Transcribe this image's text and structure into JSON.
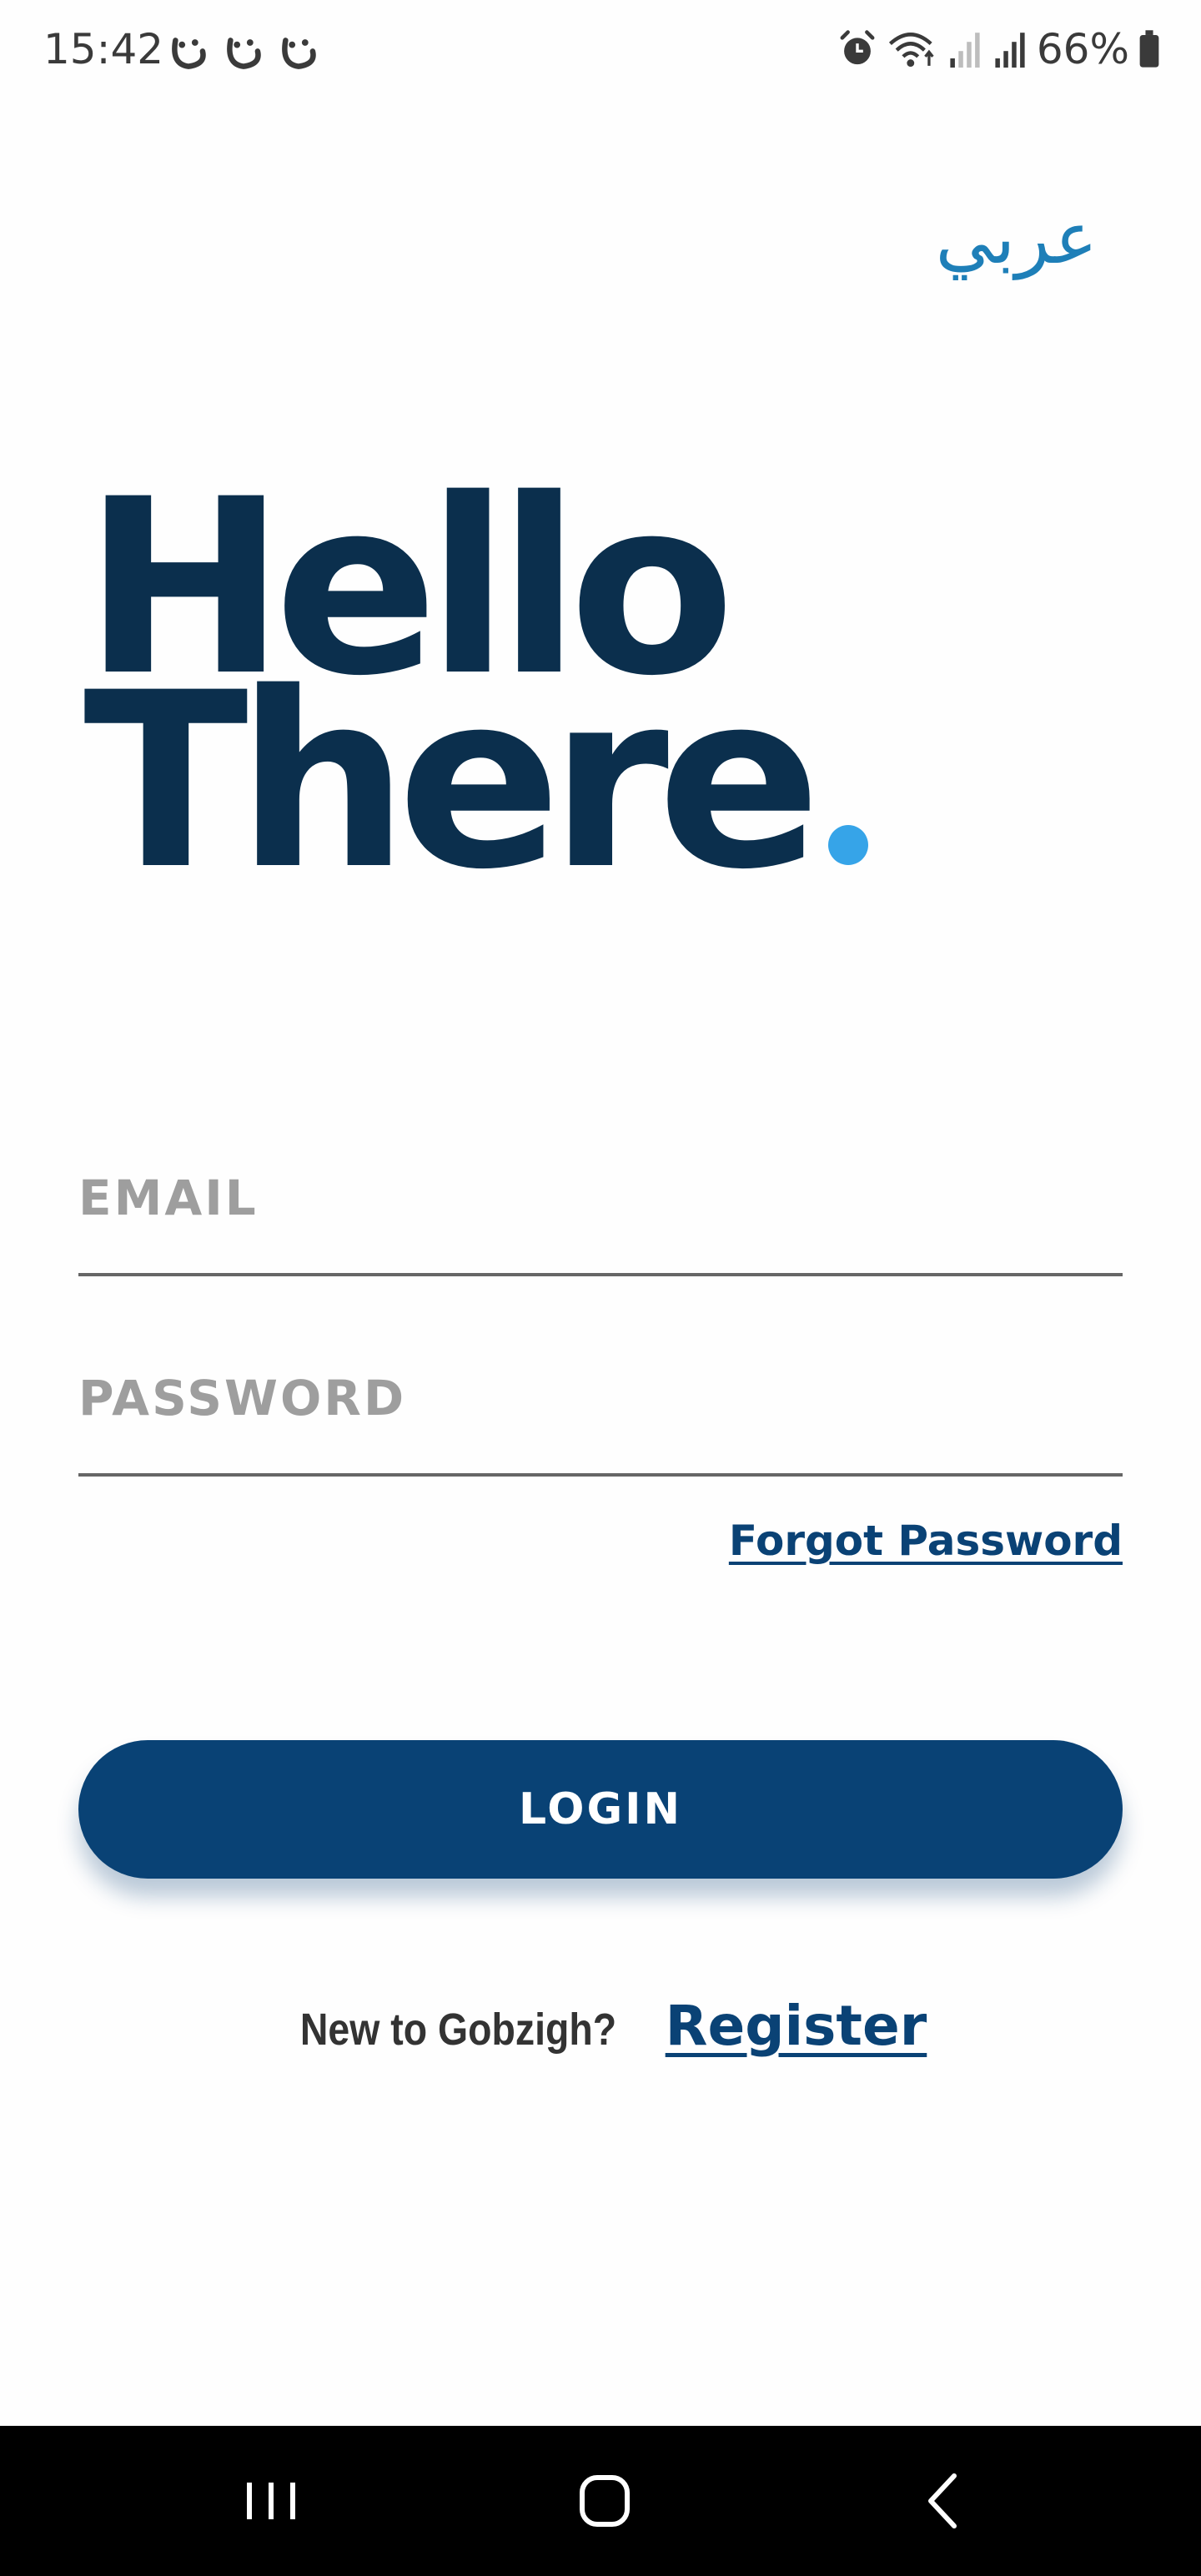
{
  "status_bar": {
    "time": "15:42",
    "notification_icons": [
      "face-icon",
      "face-icon",
      "face-icon"
    ],
    "system_icons": [
      "alarm-icon",
      "wifi-icon",
      "signal-weak-icon",
      "signal-icon",
      "battery-icon"
    ],
    "battery_percent": "66%"
  },
  "language_toggle": {
    "label": "عربي"
  },
  "hero": {
    "line1": "Hello",
    "line2": "There",
    "dot_color": "#36a4e8",
    "text_color": "#0b2f4d"
  },
  "form": {
    "email_placeholder": "EMAIL",
    "email_value": "",
    "password_placeholder": "PASSWORD",
    "password_value": "",
    "forgot_label": "Forgot Password",
    "login_label": "LOGIN"
  },
  "register": {
    "prompt": "New to Gobzigh?",
    "link_label": "Register"
  },
  "colors": {
    "primary": "#094275",
    "accent": "#36a4e8",
    "link": "#1e7fb8"
  },
  "nav_bar": {
    "buttons": [
      "recents-icon",
      "home-icon",
      "back-icon"
    ]
  }
}
